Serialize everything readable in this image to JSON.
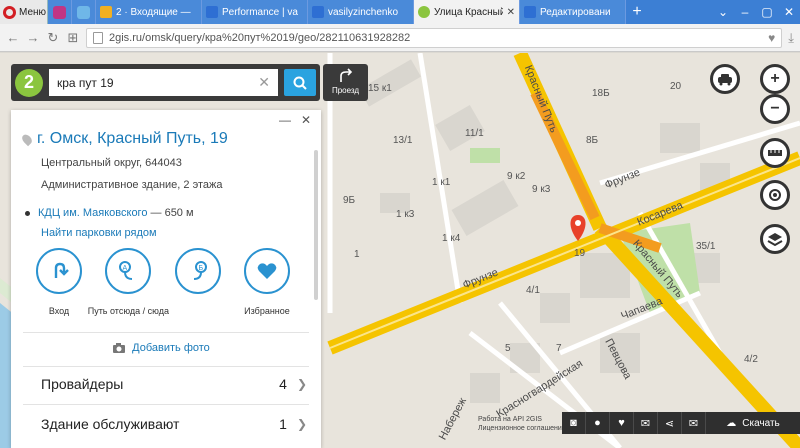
{
  "browser": {
    "menu_label": "Меню",
    "tabs": [
      {
        "label": "2 · Входящие —",
        "color": "#f1b021",
        "active": false
      },
      {
        "label": "Performance | va",
        "color": "#2e6fd3",
        "active": false
      },
      {
        "label": "vasilyzinchenko",
        "color": "#2e6fd3",
        "active": false
      },
      {
        "label": "Улица Красный П",
        "color": "#8bc53f",
        "active": true
      },
      {
        "label": "Редактировани",
        "color": "#2e6fd3",
        "active": false
      }
    ],
    "url": "2gis.ru/omsk/query/кра%20пут%2019/geo/282110631928282"
  },
  "search": {
    "query": "кра пут 19",
    "logo": "2",
    "route_label": "Проезд"
  },
  "card": {
    "title": "г. Омск, Красный Путь, 19",
    "district": "Центральный округ, 644043",
    "building": "Административное здание, 2 этажа",
    "metro_name": "КДЦ им. Маяковского",
    "metro_distance": "— 650 м",
    "parking_link": "Найти парковки рядом",
    "actions": [
      {
        "label": "Вход",
        "icon": "entrance-icon"
      },
      {
        "label": "Путь отсюда / сюда",
        "icon": "route-icon"
      },
      {
        "label": "Избранное",
        "icon": "heart-icon"
      }
    ],
    "add_photo": "Добавить фото",
    "sections": [
      {
        "label": "Провайдеры",
        "count": "4"
      },
      {
        "label": "Здание обслуживают",
        "count": "1"
      }
    ]
  },
  "map": {
    "streets": {
      "krasny_put": "Красный Путь",
      "frunze": "Фрунзе",
      "kosareva": "Косарева",
      "chapaeva": "Чапаева",
      "pevtsova": "Певцова",
      "krasnogvard": "Красногвардейская",
      "naberezh": "Набереж"
    },
    "houses": [
      "15 к1",
      "13/1",
      "11/1",
      "9 к3",
      "9Б",
      "1 к1",
      "1 к3",
      "1 к4",
      "9 к2",
      "1",
      "19",
      "8Б",
      "4/1",
      "5",
      "7",
      "35/1",
      "20",
      "18Б",
      "4/2"
    ],
    "copyright_line1": "Работа на API 2GIS",
    "copyright_line2": "Лицензионное соглашение",
    "download_label": "Скачать"
  },
  "colors": {
    "accent": "#2aa3e0",
    "brand_green": "#8bc53f",
    "link": "#1a7ab8",
    "marker": "#e8412a",
    "road_main": "#f5c400",
    "road_hot": "#f39c1f"
  }
}
